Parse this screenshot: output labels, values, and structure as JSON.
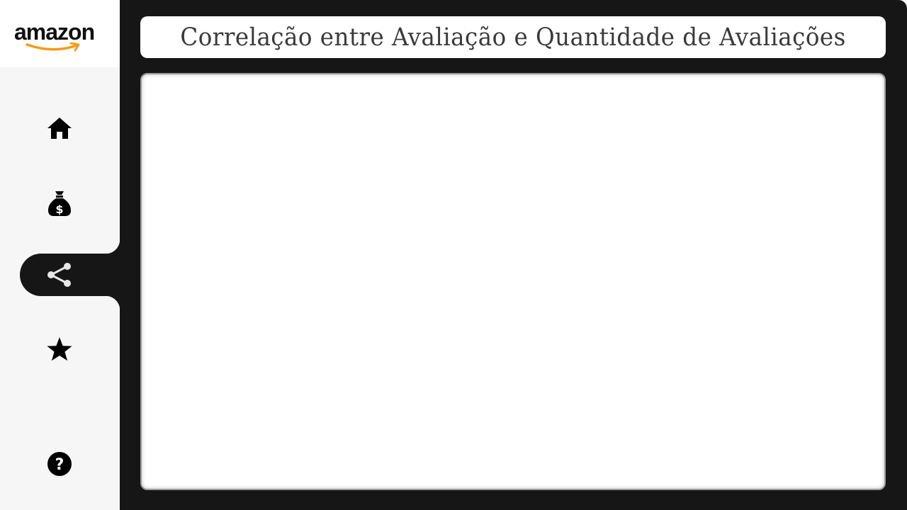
{
  "sidebar": {
    "logo": {
      "text": "amazon",
      "smile_color": "#f59a16"
    },
    "nav_items": [
      {
        "name": "home",
        "icon": "home-icon",
        "active": false
      },
      {
        "name": "sales",
        "icon": "money-bag-icon",
        "active": false
      },
      {
        "name": "correlation",
        "icon": "share-nodes-icon",
        "active": true
      },
      {
        "name": "ratings",
        "icon": "star-icon",
        "active": false
      }
    ],
    "help": {
      "icon": "question-circle-icon"
    }
  },
  "header": {
    "title": "Correlação entre Avaliação e Quantidade de Avaliações"
  },
  "main": {
    "panel_state": "empty"
  },
  "colors": {
    "background": "#161616",
    "sidebar": "#f6f6f6",
    "surface": "#ffffff",
    "title_text": "#3a3a3a",
    "active_icon": "#e6e6e6",
    "icon": "#000000"
  }
}
